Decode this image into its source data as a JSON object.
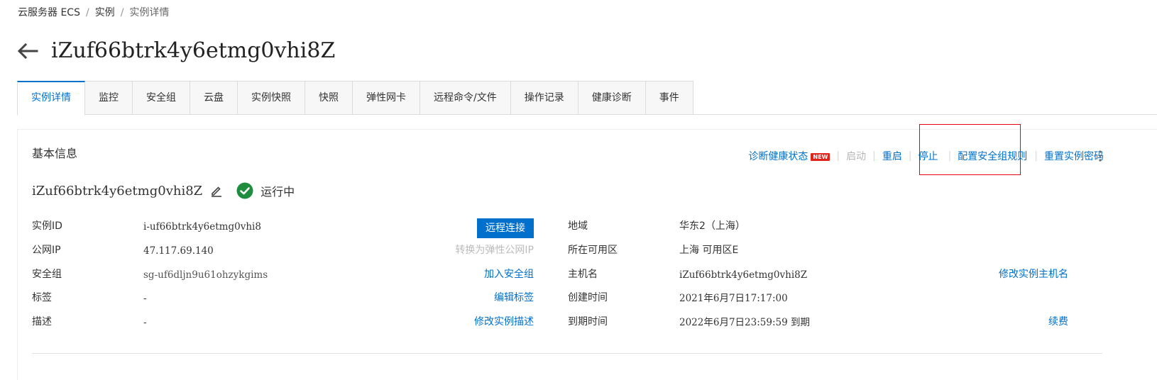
{
  "breadcrumb": {
    "items": [
      "云服务器 ECS",
      "实例",
      "实例详情"
    ],
    "separator": "/"
  },
  "page": {
    "title": "iZuf66btrk4y6etmg0vhi8Z",
    "back_icon": "arrow-left-icon"
  },
  "tabs": [
    {
      "label": "实例详情",
      "active": true
    },
    {
      "label": "监控"
    },
    {
      "label": "安全组"
    },
    {
      "label": "云盘"
    },
    {
      "label": "实例快照"
    },
    {
      "label": "快照"
    },
    {
      "label": "弹性网卡"
    },
    {
      "label": "远程命令/文件"
    },
    {
      "label": "操作记录"
    },
    {
      "label": "健康诊断"
    },
    {
      "label": "事件"
    }
  ],
  "basic_info": {
    "section_title": "基本信息",
    "actions": {
      "diagnose": "诊断健康状态",
      "new_badge": "NEW",
      "start": "启动",
      "restart": "重启",
      "stop": "停止",
      "config_security_rules": "配置安全组规则",
      "reset_password": "重置实例密码"
    },
    "instance_name": "iZuf66btrk4y6etmg0vhi8Z",
    "status": "运行中",
    "left_rows": {
      "instance_id": {
        "label": "实例ID",
        "value": "i-uf66btrk4y6etmg0vhi8",
        "action": "远程连接"
      },
      "public_ip": {
        "label": "公网IP",
        "value": "47.117.69.140",
        "action": "转换为弹性公网IP"
      },
      "security_group": {
        "label": "安全组",
        "value": "sg-uf6dljn9u61ohzykgims",
        "action": "加入安全组"
      },
      "tags": {
        "label": "标签",
        "value": "-",
        "action": "编辑标签"
      },
      "description": {
        "label": "描述",
        "value": "-",
        "action": "修改实例描述"
      }
    },
    "right_rows": {
      "region": {
        "label": "地域",
        "value": "华东2（上海）"
      },
      "zone": {
        "label": "所在可用区",
        "value": "上海 可用区E"
      },
      "hostname": {
        "label": "主机名",
        "value": "iZuf66btrk4y6etmg0vhi8Z",
        "action": "修改实例主机名"
      },
      "created": {
        "label": "创建时间",
        "value": "2021年6月7日17:17:00"
      },
      "expires": {
        "label": "到期时间",
        "value": "2022年6月7日23:59:59 到期",
        "action": "续费"
      }
    }
  },
  "colors": {
    "link": "#0070cc",
    "status_ok": "#1e8e3e",
    "highlight": "#e60012",
    "badge": "#e2231a"
  }
}
